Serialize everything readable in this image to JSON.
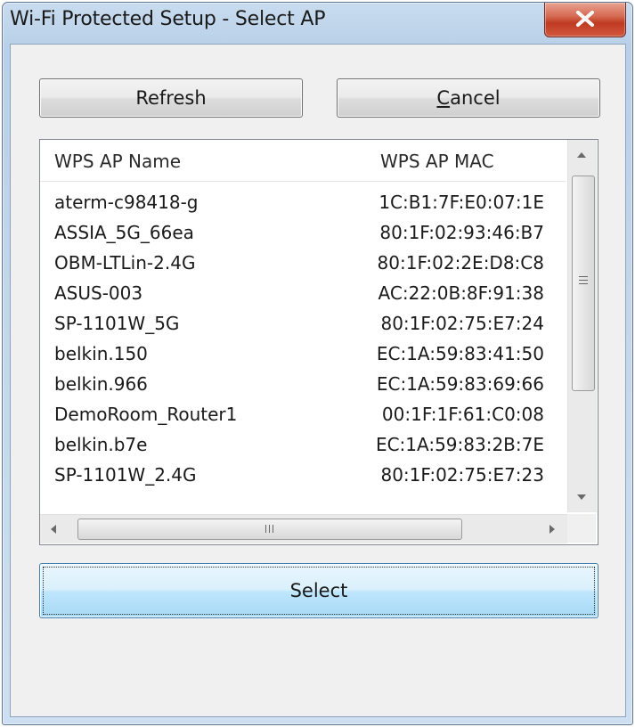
{
  "window": {
    "title": "Wi-Fi Protected Setup - Select AP",
    "close_glyph": "x"
  },
  "buttons": {
    "refresh_label": "Refresh",
    "cancel_label_first": "C",
    "cancel_label_rest": "ancel",
    "select_label": "Select"
  },
  "list": {
    "columns": [
      "WPS AP Name",
      "WPS AP MAC"
    ],
    "rows": [
      {
        "name": "aterm-c98418-g",
        "mac": "1C:B1:7F:E0:07:1E"
      },
      {
        "name": "ASSIA_5G_66ea",
        "mac": "80:1F:02:93:46:B7"
      },
      {
        "name": "OBM-LTLin-2.4G",
        "mac": "80:1F:02:2E:D8:C8"
      },
      {
        "name": "ASUS-003",
        "mac": "AC:22:0B:8F:91:38"
      },
      {
        "name": "SP-1101W_5G",
        "mac": "80:1F:02:75:E7:24"
      },
      {
        "name": "belkin.150",
        "mac": "EC:1A:59:83:41:50"
      },
      {
        "name": "belkin.966",
        "mac": "EC:1A:59:83:69:66"
      },
      {
        "name": "DemoRoom_Router1",
        "mac": "00:1F:1F:61:C0:08"
      },
      {
        "name": "belkin.b7e",
        "mac": "EC:1A:59:83:2B:7E"
      },
      {
        "name": "SP-1101W_2.4G",
        "mac": "80:1F:02:75:E7:23"
      }
    ]
  },
  "colors": {
    "close_button": "#c8442a",
    "select_button": "#bee6fd",
    "window_frame": "#c3d6ea"
  }
}
